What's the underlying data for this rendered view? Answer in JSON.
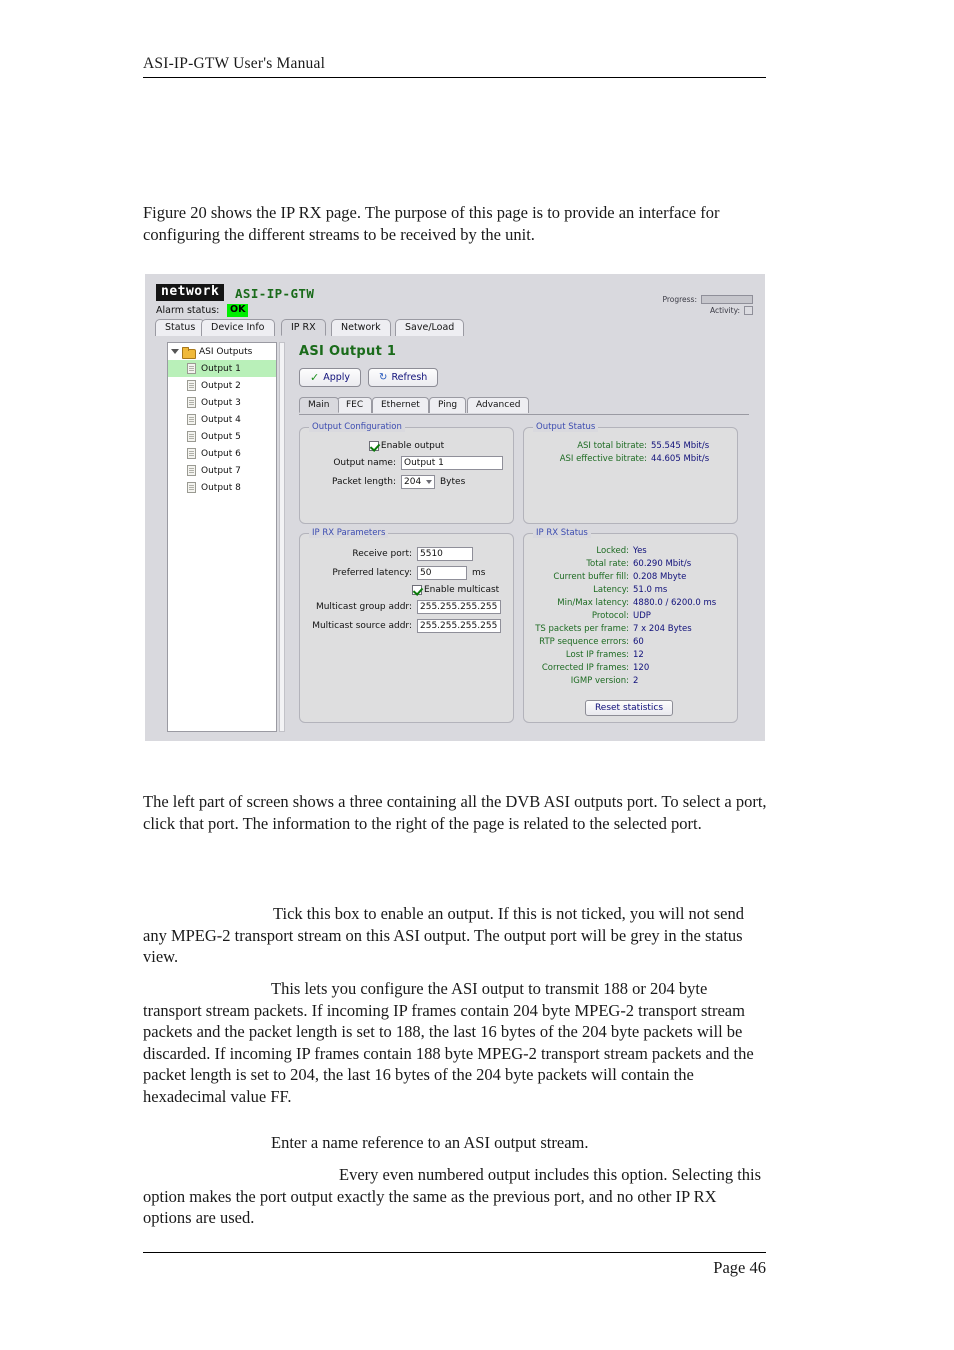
{
  "document": {
    "running_header": "ASI-IP-GTW User's Manual",
    "footer": "Page 46",
    "paragraphs": {
      "intro": "Figure 20 shows the IP RX page. The purpose of this page is to provide an interface for configuring the different streams to be received by the unit.",
      "tree_desc": "The left part of screen shows a three containing all the DVB ASI outputs port. To select a port, click that port. The information to the right of the page is related to the selected port.",
      "enable_output": "Tick this box to enable an output. If this is not ticked, you will not send any MPEG-2 transport stream on this ASI output. The output port will be grey in the status view.",
      "packet_length": "This lets you configure the ASI output to transmit 188 or 204 byte transport stream packets. If incoming IP frames contain 204 byte MPEG-2 transport stream packets and the packet length is set to 188, the last 16 bytes of the 204 byte packets will be discarded. If incoming IP frames contain 188 byte MPEG-2 transport stream packets and the packet length is set to 204, the last 16 bytes of the 204 byte packets will contain the hexadecimal value FF.",
      "output_name": "Enter a name reference to an ASI output stream.",
      "even_output": "Every even numbered output includes this option. Selecting this option makes the port output exactly the same as the previous port, and no other IP RX options are used."
    }
  },
  "app": {
    "logo_text": "network",
    "product_title": "ASI-IP-GTW",
    "alarm": {
      "label": "Alarm status:",
      "value": "OK",
      "color": "#00ee00"
    },
    "indicators": {
      "progress_label": "Progress:",
      "activity_label": "Activity:"
    },
    "main_tabs": [
      {
        "label": "Status",
        "selected": false
      },
      {
        "label": "Device Info",
        "selected": false
      },
      {
        "label": "IP RX",
        "selected": true
      },
      {
        "label": "Network",
        "selected": false
      },
      {
        "label": "Save/Load",
        "selected": false
      }
    ],
    "tree": {
      "root_label": "ASI Outputs",
      "items": [
        {
          "label": "Output 1",
          "selected": true
        },
        {
          "label": "Output 2",
          "selected": false
        },
        {
          "label": "Output 3",
          "selected": false
        },
        {
          "label": "Output 4",
          "selected": false
        },
        {
          "label": "Output 5",
          "selected": false
        },
        {
          "label": "Output 6",
          "selected": false
        },
        {
          "label": "Output 7",
          "selected": false
        },
        {
          "label": "Output 8",
          "selected": false
        }
      ]
    },
    "panel": {
      "title": "ASI Output 1",
      "apply_label": "Apply",
      "refresh_label": "Refresh",
      "sub_tabs": [
        {
          "label": "Main",
          "selected": true
        },
        {
          "label": "FEC",
          "selected": false
        },
        {
          "label": "Ethernet",
          "selected": false
        },
        {
          "label": "Ping",
          "selected": false
        },
        {
          "label": "Advanced",
          "selected": false
        }
      ],
      "output_configuration": {
        "legend": "Output Configuration",
        "enable_output_label": "Enable output",
        "enable_output_checked": true,
        "output_name_label": "Output name:",
        "output_name_value": "Output 1",
        "packet_length_label": "Packet length:",
        "packet_length_value": "204",
        "packet_length_options": [
          "188",
          "204"
        ],
        "packet_length_units": "Bytes"
      },
      "output_status": {
        "legend": "Output Status",
        "rows": [
          {
            "key": "ASI total bitrate:",
            "value": "55.545 Mbit/s"
          },
          {
            "key": "ASI effective bitrate:",
            "value": "44.605 Mbit/s"
          }
        ]
      },
      "ip_rx_parameters": {
        "legend": "IP RX Parameters",
        "receive_port_label": "Receive port:",
        "receive_port_value": "5510",
        "preferred_latency_label": "Preferred latency:",
        "preferred_latency_value": "50",
        "preferred_latency_units": "ms",
        "enable_multicast_label": "Enable multicast",
        "enable_multicast_checked": true,
        "multicast_group_label": "Multicast group addr:",
        "multicast_group_value": "255.255.255.255",
        "multicast_source_label": "Multicast source addr:",
        "multicast_source_value": "255.255.255.255"
      },
      "ip_rx_status": {
        "legend": "IP RX Status",
        "rows": [
          {
            "key": "Locked:",
            "value": "Yes"
          },
          {
            "key": "Total rate:",
            "value": "60.290 Mbit/s"
          },
          {
            "key": "Current buffer fill:",
            "value": "0.208 Mbyte"
          },
          {
            "key": "Latency:",
            "value": "51.0 ms"
          },
          {
            "key": "Min/Max latency:",
            "value": "4880.0 / 6200.0 ms"
          },
          {
            "key": "Protocol:",
            "value": "UDP"
          },
          {
            "key": "TS packets per frame:",
            "value": "7 x 204 Bytes"
          },
          {
            "key": "RTP sequence errors:",
            "value": "60"
          },
          {
            "key": "Lost IP frames:",
            "value": "12"
          },
          {
            "key": "Corrected IP frames:",
            "value": "120"
          },
          {
            "key": "IGMP version:",
            "value": "2"
          }
        ],
        "reset_label": "Reset statistics"
      }
    }
  }
}
